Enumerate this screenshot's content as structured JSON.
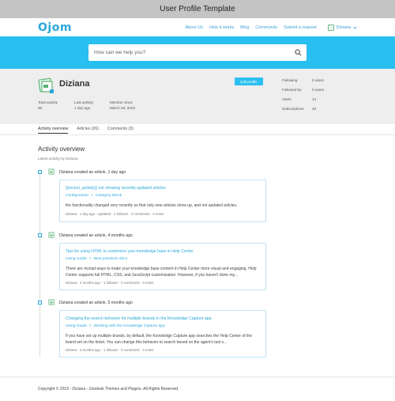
{
  "window": {
    "title": "User Profile Template"
  },
  "brand": {
    "logo_text": "Ojom",
    "accent": "#29bff1",
    "link_color": "#2aa7d9"
  },
  "nav": {
    "links": [
      "About Us",
      "How it works",
      "Blog",
      "Community",
      "Submit a request"
    ],
    "user": "Diziana",
    "user_menu_icon": "chevron-down-icon"
  },
  "search": {
    "placeholder": "How can we help you?",
    "icon": "search-icon"
  },
  "profile": {
    "name": "Diziana",
    "edit_label": "Edit profile",
    "stats": [
      {
        "label": "Total activity",
        "value": "86"
      },
      {
        "label": "Last activity",
        "value": "1 day ago"
      },
      {
        "label": "Member since",
        "value": "March 28, 2019"
      }
    ],
    "right_stats": [
      {
        "label": "Following",
        "value": "0 users"
      },
      {
        "label": "Followed by",
        "value": "0 users"
      },
      {
        "label": "Votes",
        "value": "14"
      },
      {
        "label": "Subscriptions",
        "value": "43"
      }
    ]
  },
  "tabs": [
    {
      "label": "Activity overview",
      "active": true
    },
    {
      "label": "Articles (26)",
      "active": false
    },
    {
      "label": "Comments (3)",
      "active": false
    }
  ],
  "activity": {
    "title": "Activity overview",
    "subtitle": "Latest activity by Diziana",
    "entries": [
      {
        "author": "Diziana",
        "action": "created an article, 1 day ago",
        "title": "{{recent_activity}} not showing recently updated articles",
        "breadcrumb": [
          "Configuration",
          "Category Block"
        ],
        "excerpt": "the functionality changed very recently so that only new articles show up, and not updated articles.",
        "meta": [
          "Diziana",
          "1 day ago",
          "Updated",
          "1 follower",
          "0 comments",
          "0 votes"
        ]
      },
      {
        "author": "Diziana",
        "action": "created an article, 4 months ago",
        "title": "Tips for using HTML to customize your knowledge base in Help Center",
        "breadcrumb": [
          "Using Guide",
          "Best practices docs"
        ],
        "excerpt": "There are myriad ways to make your knowledge base content in Help Center more visual and engaging. Help Center supports full HTML, CSS, and JavaScript customization. However, if you haven't done my...",
        "meta": [
          "Diziana",
          "4 months ago",
          "1 follower",
          "0 comments",
          "0 votes"
        ]
      },
      {
        "author": "Diziana",
        "action": "created an article, 5 months ago",
        "title": "Changing the search behavior for multiple brands in the Knowledge Capture app",
        "breadcrumb": [
          "Using Guide",
          "Working with the Knowledge Capture app"
        ],
        "excerpt": "If you have set up multiple brands, by default, the Knowledge Capture app searches the Help Center of the brand set on the ticket. You can change this behavior to search based on the agent's last s...",
        "meta": [
          "Diziana",
          "5 months ago",
          "1 follower",
          "0 comments",
          "0 votes"
        ]
      }
    ]
  },
  "footer": {
    "text": "Copyright © 2019 - Diziana - Zendesk Themes and Plugins. All Rights Reserved."
  }
}
